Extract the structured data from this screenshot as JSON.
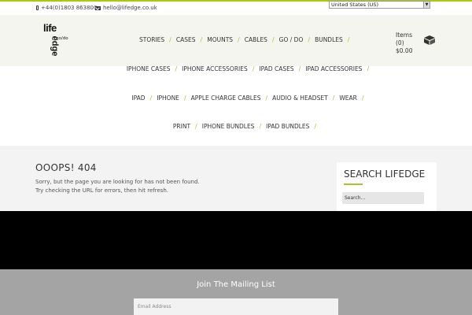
{
  "topbar": {
    "phone": "+44(0)1803 863800",
    "email": "hello@lifedge.co.uk",
    "country": "United States (US)"
  },
  "logo": {
    "text_top": "life",
    "text_side": "edge",
    "tagline": "go/do"
  },
  "main_nav": [
    "STORIES",
    "CASES",
    "MOUNTS",
    "CABLES",
    "GO / DO",
    "BUNDLES"
  ],
  "cart": {
    "label": "Items",
    "count": "(0)",
    "total": "$0.00"
  },
  "sub_nav": {
    "row1": [
      "IPHONE CASES",
      "IPHONE ACCESSORIES",
      "IPAD CASES",
      "IPAD ACCESSORIES"
    ],
    "row2": [
      "IPAD",
      "IPHONE",
      "APPLE CHARGE CABLES",
      "AUDIO & HEADSET",
      "WEAR"
    ],
    "row3": [
      "PRINT",
      "IPHONE BUNDLES",
      "IPAD BUNDLES"
    ]
  },
  "error": {
    "title": "OOOPS! 404",
    "line1": "Sorry, but the page you are looking for has not been found.",
    "line2": "Try checking the URL for errors, then hit refresh."
  },
  "search": {
    "title": "SEARCH LIFEDGE",
    "placeholder": "Search..."
  },
  "footer": {
    "title": "Join The Mailing List",
    "email_placeholder": "Email Address"
  },
  "colors": {
    "accent": "#a8c52a",
    "header_bg": "#f5f5ef",
    "footer_bg": "#a4a4a4"
  },
  "icons": {
    "cart": "box-icon",
    "phone": "phone-icon",
    "email": "envelope-icon"
  }
}
